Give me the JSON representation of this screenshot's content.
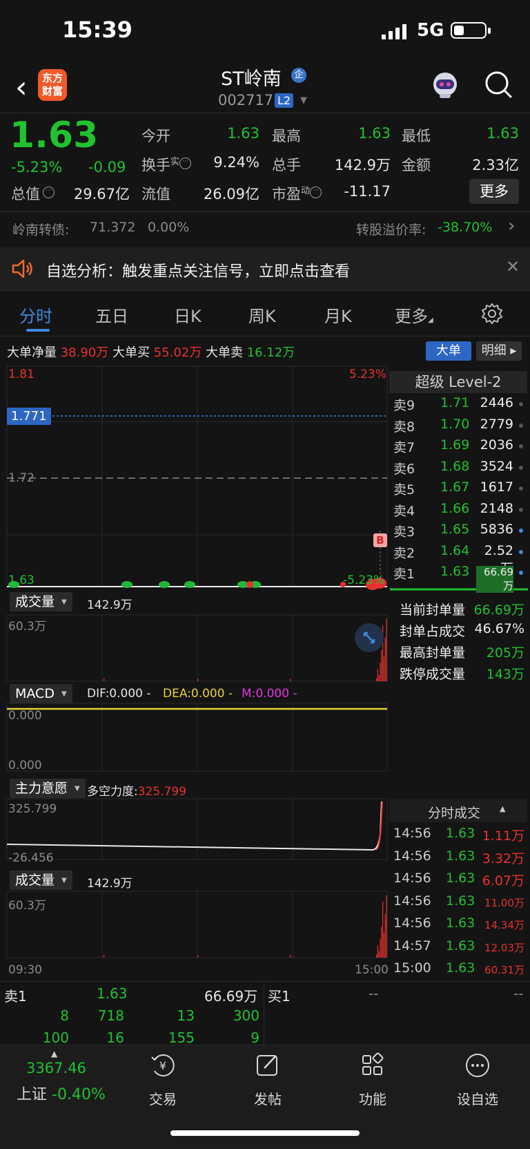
{
  "status": {
    "time": "15:39",
    "network": "5G"
  },
  "header": {
    "back": "‹",
    "logo_text": "东方财富",
    "stock_name": "ST岭南",
    "badge": "企",
    "code": "002717",
    "l2": "L2"
  },
  "quote": {
    "price": "1.63",
    "change_pct": "-5.23%",
    "change": "-0.09",
    "open_label": "今开",
    "open": "1.63",
    "high_label": "最高",
    "high": "1.63",
    "low_label": "最低",
    "low": "1.63",
    "turnover_label": "换手",
    "turnover_sup": "实",
    "turnover": "9.24%",
    "volume_label": "总手",
    "volume": "142.9万",
    "amount_label": "金额",
    "amount": "2.33亿",
    "mktcap_label": "总值",
    "mktcap": "29.67亿",
    "float_label": "流值",
    "float": "26.09亿",
    "pe_label": "市盈",
    "pe_sup": "动",
    "pe": "-11.17",
    "more": "更多"
  },
  "bond": {
    "label": "岭南转债:",
    "price": "71.372",
    "pct": "0.00%",
    "premium_label": "转股溢价率:",
    "premium": "-38.70%"
  },
  "notice": {
    "text": "自选分析：触发重点关注信号，立即点击查看"
  },
  "tabs": [
    "分时",
    "五日",
    "日K",
    "周K",
    "月K",
    "更多"
  ],
  "big_orders": {
    "net_label": "大单净量",
    "net": "38.90万",
    "buy_label": "大单买",
    "buy": "55.02万",
    "sell_label": "大单卖",
    "sell": "16.12万",
    "btn_big": "大单",
    "btn_detail": "明细"
  },
  "chart": {
    "y_max": "1.81",
    "y_max_pct": "5.23%",
    "y_cursor": "1.771",
    "y_prev": "1.72",
    "y_min": "1.63",
    "y_min_pct": "-5.23%",
    "marker": "B",
    "vol_selector": "成交量",
    "vol_total": "142.9万",
    "vol_max": "60.3万",
    "macd_selector": "MACD",
    "dif": "DIF:0.000 -",
    "dea": "DEA:0.000 -",
    "m": "M:0.000 -",
    "macd_top": "0.000",
    "macd_bottom": "0.000",
    "will_selector": "主力意愿",
    "will_label": "多空力度:",
    "will_value": "325.799",
    "will_max": "325.799",
    "will_min": "-26.456",
    "vol2_selector": "成交量",
    "vol2_total": "142.9万",
    "vol2_max": "60.3万",
    "time_start": "09:30",
    "time_end": "15:00"
  },
  "orderbook": {
    "title": "超级 Level-2",
    "asks": [
      {
        "label": "卖9",
        "price": "1.71",
        "vol": "2446"
      },
      {
        "label": "卖8",
        "price": "1.70",
        "vol": "2779"
      },
      {
        "label": "卖7",
        "price": "1.69",
        "vol": "2036"
      },
      {
        "label": "卖6",
        "price": "1.68",
        "vol": "3524"
      },
      {
        "label": "卖5",
        "price": "1.67",
        "vol": "1617"
      },
      {
        "label": "卖4",
        "price": "1.66",
        "vol": "2148"
      },
      {
        "label": "卖3",
        "price": "1.65",
        "vol": "5836"
      },
      {
        "label": "卖2",
        "price": "1.64",
        "vol": "2.52万"
      },
      {
        "label": "卖1",
        "price": "1.63",
        "vol": "66.69万"
      }
    ],
    "seal": [
      {
        "label": "当前封单量",
        "value": "66.69万"
      },
      {
        "label": "封单占成交",
        "value": "46.67%"
      },
      {
        "label": "最高封单量",
        "value": "205万"
      },
      {
        "label": "跌停成交量",
        "value": "143万"
      }
    ],
    "ticks_title": "分时成交",
    "ticks": [
      {
        "time": "14:56",
        "price": "1.63",
        "vol": "1.11万"
      },
      {
        "time": "14:56",
        "price": "1.63",
        "vol": "3.32万"
      },
      {
        "time": "14:56",
        "price": "1.63",
        "vol": "6.07万"
      },
      {
        "time": "14:56",
        "price": "1.63",
        "vol": "11.00万"
      },
      {
        "time": "14:56",
        "price": "1.63",
        "vol": "14.34万"
      },
      {
        "time": "14:57",
        "price": "1.63",
        "vol": "12.03万"
      },
      {
        "time": "15:00",
        "price": "1.63",
        "vol": "60.31万"
      }
    ]
  },
  "bottom": {
    "sell1_label": "卖1",
    "sell1_price": "1.63",
    "sell1_vol": "66.69万",
    "buy1_label": "买1",
    "buy1_price": "--",
    "buy1_vol": "--",
    "row1": [
      "8",
      "718",
      "13",
      "300"
    ],
    "row2": [
      "100",
      "16",
      "155",
      "9"
    ]
  },
  "nav": {
    "index_value": "3367.46",
    "index_name": "上证",
    "index_pct": "-0.40%",
    "trade": "交易",
    "post": "发帖",
    "func": "功能",
    "watch": "设自选"
  },
  "colors": {
    "up": "#e8312f",
    "down": "#21c12f",
    "accent": "#2d66c3",
    "bg": "#141414"
  }
}
